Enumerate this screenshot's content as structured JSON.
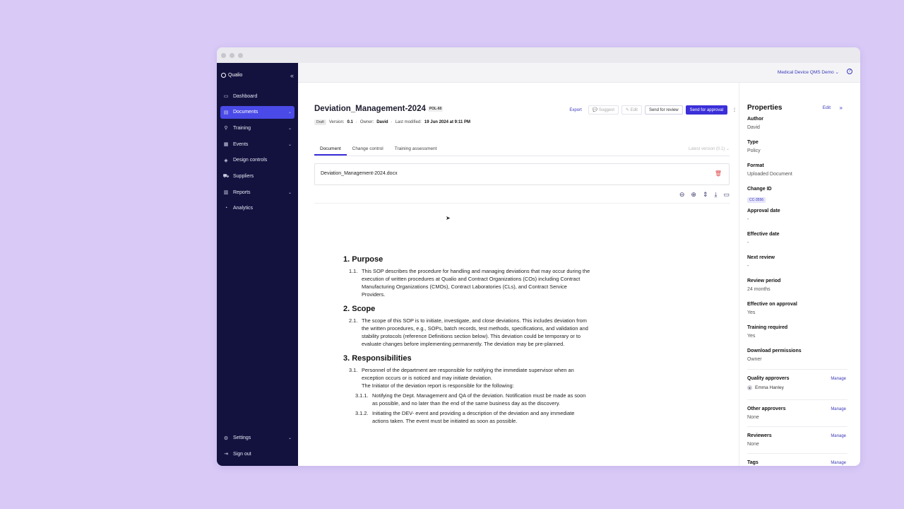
{
  "sidebar": {
    "brand": "Qualio",
    "collapse_icon": "«",
    "items": [
      {
        "label": "Dashboard",
        "icon": "▭",
        "chevron": ""
      },
      {
        "label": "Documents",
        "icon": "▤",
        "chevron": "⌄"
      },
      {
        "label": "Training",
        "icon": "⚲",
        "chevron": "⌄"
      },
      {
        "label": "Events",
        "icon": "▦",
        "chevron": "⌄"
      },
      {
        "label": "Design controls",
        "icon": "◈",
        "chevron": ""
      },
      {
        "label": "Suppliers",
        "icon": "⛟",
        "chevron": ""
      },
      {
        "label": "Reports",
        "icon": "▥",
        "chevron": "⌄"
      },
      {
        "label": "Analytics",
        "icon": "◔",
        "chevron": ""
      }
    ],
    "bottom": [
      {
        "label": "Settings",
        "icon": "⚙",
        "chevron": "⌄"
      },
      {
        "label": "Sign out",
        "icon": "⇥",
        "chevron": ""
      }
    ]
  },
  "topbar": {
    "workspace": "Medical Device QMS Demo ⌄",
    "help_icon": "?"
  },
  "document": {
    "title": "Deviation_Management-2024",
    "code": "POL-60",
    "status": "Draft",
    "version_label": "Version:",
    "version": "0.1",
    "owner_label": "Owner:",
    "owner": "David",
    "modified_label": "Last modified:",
    "modified": "19 Jun 2024 at 9:11 PM",
    "separator": "·"
  },
  "actions": {
    "export": "Export",
    "suggest": "💬 Suggest",
    "edit": "✎ Edit",
    "send_review": "Send for review",
    "send_approval": "Send for approval",
    "more": "⋮"
  },
  "tabs": [
    "Document",
    "Change control",
    "Training assessment"
  ],
  "latest_version": "Latest version (0.1) ⌄",
  "file": {
    "name": "Deviation_Management-2024.docx",
    "delete_icon": "🗑"
  },
  "viewer_tools": {
    "zoom_out": "⊖",
    "zoom_in": "⊕",
    "fit": "⇕",
    "download": "⤓",
    "comment": "▭"
  },
  "content": {
    "h1": "1. Purpose",
    "p1_num": "1.1.",
    "p1": "This SOP describes the procedure for handling and managing deviations that may occur during the execution of written procedures at Qualio and Contract Organizations (COs) including Contract Manufacturing Organizations (CMOs), Contract Laboratories (CLs), and Contract Service Providers.",
    "h2": "2. Scope",
    "p2_num": "2.1.",
    "p2": "The scope of this SOP is to initiate, investigate, and close deviations. This includes deviation from the written procedures, e.g., SOPs, batch records, test methods, specifications, and validation and stability protocols (reference Definitions section below). This deviation could be temporary or to evaluate changes before implementing permanently. The deviation may be pre-planned.",
    "h3": "3. Responsibilities",
    "p3_num": "3.1.",
    "p3": "Personnel of the department are responsible for notifying the immediate supervisor when an exception occurs or is noticed and may initiate deviation.",
    "p3b": "The Initiator of the deviation report is responsible for the following:",
    "p311_num": "3.1.1.",
    "p311": "Notifying the Dept. Management and QA of the deviation.  Notification must be made as soon as possible, and no later than the end of the same business day as the discovery.",
    "p312_num": "3.1.2.",
    "p312": "Initiating the DEV- event and providing a description of the deviation and any immediate actions taken.  The event must be initiated as soon as possible."
  },
  "properties": {
    "title": "Properties",
    "edit": "Edit",
    "close_icon": "»",
    "author_label": "Author",
    "author": "David",
    "type_label": "Type",
    "type": "Policy",
    "format_label": "Format",
    "format": "Uploaded Document",
    "change_id_label": "Change ID",
    "change_id": "CC-3556",
    "approval_label": "Approval date",
    "approval": "-",
    "effective_label": "Effective date",
    "effective": "-",
    "next_review_label": "Next review",
    "next_review": "-",
    "review_period_label": "Review period",
    "review_period": "24 months",
    "effective_on_label": "Effective on approval",
    "effective_on": "Yes",
    "training_label": "Training required",
    "training": "Yes",
    "download_label": "Download permissions",
    "download": "Owner",
    "quality_label": "Quality approvers",
    "quality_person": "Emma Hanley",
    "other_label": "Other approvers",
    "other": "None",
    "reviewers_label": "Reviewers",
    "reviewers": "None",
    "tags_label": "Tags",
    "manage": "Manage"
  }
}
